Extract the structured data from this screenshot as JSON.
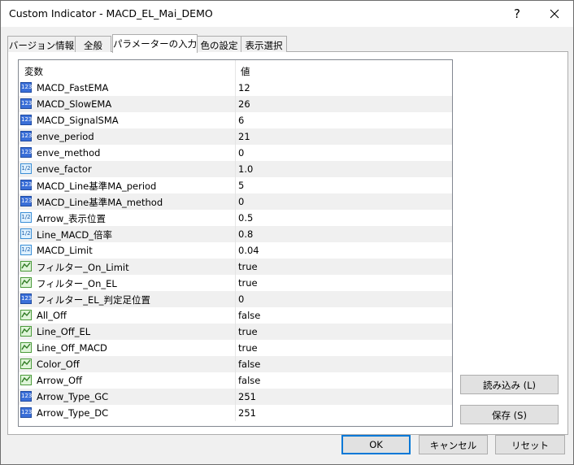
{
  "window": {
    "title": "Custom Indicator - MACD_EL_Mai_DEMO",
    "help_label": "?"
  },
  "tabs": [
    {
      "label": "バージョン情報"
    },
    {
      "label": "全般"
    },
    {
      "label": "パラメーターの入力"
    },
    {
      "label": "色の設定"
    },
    {
      "label": "表示選択"
    }
  ],
  "grid": {
    "columns": {
      "variable": "変数",
      "value": "値"
    },
    "rows": [
      {
        "icon": "int-icon",
        "name": "MACD_FastEMA",
        "value": "12"
      },
      {
        "icon": "int-icon",
        "name": "MACD_SlowEMA",
        "value": "26"
      },
      {
        "icon": "int-icon",
        "name": "MACD_SignalSMA",
        "value": "6"
      },
      {
        "icon": "int-icon",
        "name": "enve_period",
        "value": "21"
      },
      {
        "icon": "int-icon",
        "name": "enve_method",
        "value": "0"
      },
      {
        "icon": "double-icon",
        "name": "enve_factor",
        "value": "1.0"
      },
      {
        "icon": "int-icon",
        "name": "MACD_Line基準MA_period",
        "value": "5"
      },
      {
        "icon": "int-icon",
        "name": "MACD_Line基準MA_method",
        "value": "0"
      },
      {
        "icon": "double-icon",
        "name": "Arrow_表示位置",
        "value": "0.5"
      },
      {
        "icon": "double-icon",
        "name": "Line_MACD_倍率",
        "value": "0.8"
      },
      {
        "icon": "double-icon",
        "name": "MACD_Limit",
        "value": "0.04"
      },
      {
        "icon": "bool-icon",
        "name": "フィルター_On_Limit",
        "value": "true"
      },
      {
        "icon": "bool-icon",
        "name": "フィルター_On_EL",
        "value": "true"
      },
      {
        "icon": "int-icon",
        "name": "フィルター_EL_判定足位置",
        "value": "0"
      },
      {
        "icon": "bool-icon",
        "name": "All_Off",
        "value": "false"
      },
      {
        "icon": "bool-icon",
        "name": "Line_Off_EL",
        "value": "true"
      },
      {
        "icon": "bool-icon",
        "name": "Line_Off_MACD",
        "value": "true"
      },
      {
        "icon": "bool-icon",
        "name": "Color_Off",
        "value": "false"
      },
      {
        "icon": "bool-icon",
        "name": "Arrow_Off",
        "value": "false"
      },
      {
        "icon": "int-icon",
        "name": "Arrow_Type_GC",
        "value": "251"
      },
      {
        "icon": "int-icon",
        "name": "Arrow_Type_DC",
        "value": "251"
      }
    ]
  },
  "side_buttons": {
    "load": "読み込み (L)",
    "save": "保存 (S)"
  },
  "footer_buttons": {
    "ok": "OK",
    "cancel": "キャンセル",
    "reset": "リセット"
  },
  "icon_text": {
    "int": "123",
    "double": "1/2"
  },
  "colors": {
    "focus_border": "#0078d7",
    "alt_row": "#f0f0f0"
  }
}
